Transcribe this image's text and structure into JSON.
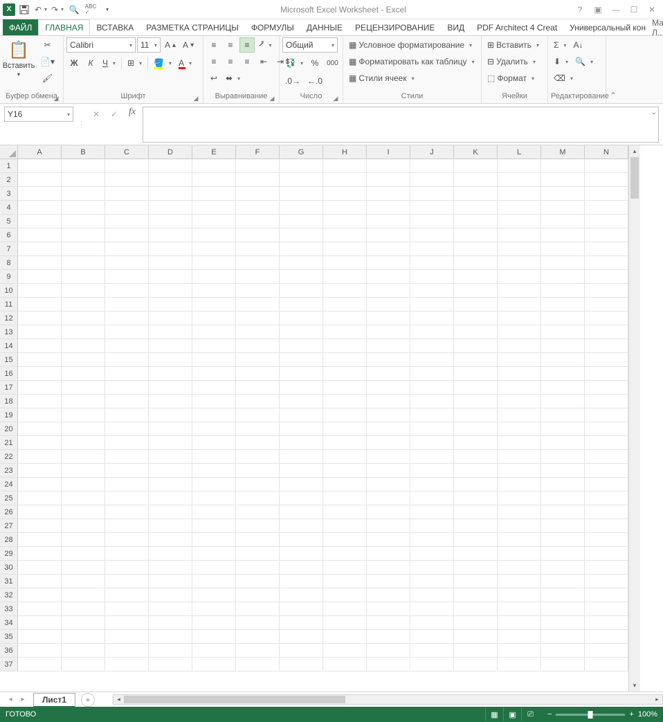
{
  "title": "Microsoft Excel Worksheet - Excel",
  "qat": {
    "save": "💾",
    "undo": "↶",
    "redo": "↷",
    "preview": "🔍",
    "spell": "ABC"
  },
  "user": {
    "name": "Мария Л..."
  },
  "tabs": {
    "file": "ФАЙЛ",
    "items": [
      "ГЛАВНАЯ",
      "ВСТАВКА",
      "РАЗМЕТКА СТРАНИЦЫ",
      "ФОРМУЛЫ",
      "ДАННЫЕ",
      "РЕЦЕНЗИРОВАНИЕ",
      "ВИД",
      "PDF Architect 4 Creat",
      "Универсальный кон"
    ],
    "active": 0
  },
  "ribbon": {
    "clipboard": {
      "paste": "Вставить",
      "label": "Буфер обмена"
    },
    "font": {
      "name": "Calibri",
      "size": "11",
      "bold": "Ж",
      "italic": "К",
      "underline": "Ч",
      "label": "Шрифт"
    },
    "align": {
      "label": "Выравнивание"
    },
    "number": {
      "format": "Общий",
      "label": "Число"
    },
    "styles": {
      "cond": "Условное форматирование",
      "table": "Форматировать как таблицу",
      "cell": "Стили ячеек",
      "label": "Стили"
    },
    "cells": {
      "insert": "Вставить",
      "delete": "Удалить",
      "format": "Формат",
      "label": "Ячейки"
    },
    "editing": {
      "label": "Редактирование"
    }
  },
  "namebox": "Y16",
  "columns": [
    "A",
    "B",
    "C",
    "D",
    "E",
    "F",
    "G",
    "H",
    "I",
    "J",
    "K",
    "L",
    "M",
    "N"
  ],
  "rows": 37,
  "sheet_tab": "Лист1",
  "status": {
    "ready": "ГОТОВО",
    "zoom": "100%"
  }
}
